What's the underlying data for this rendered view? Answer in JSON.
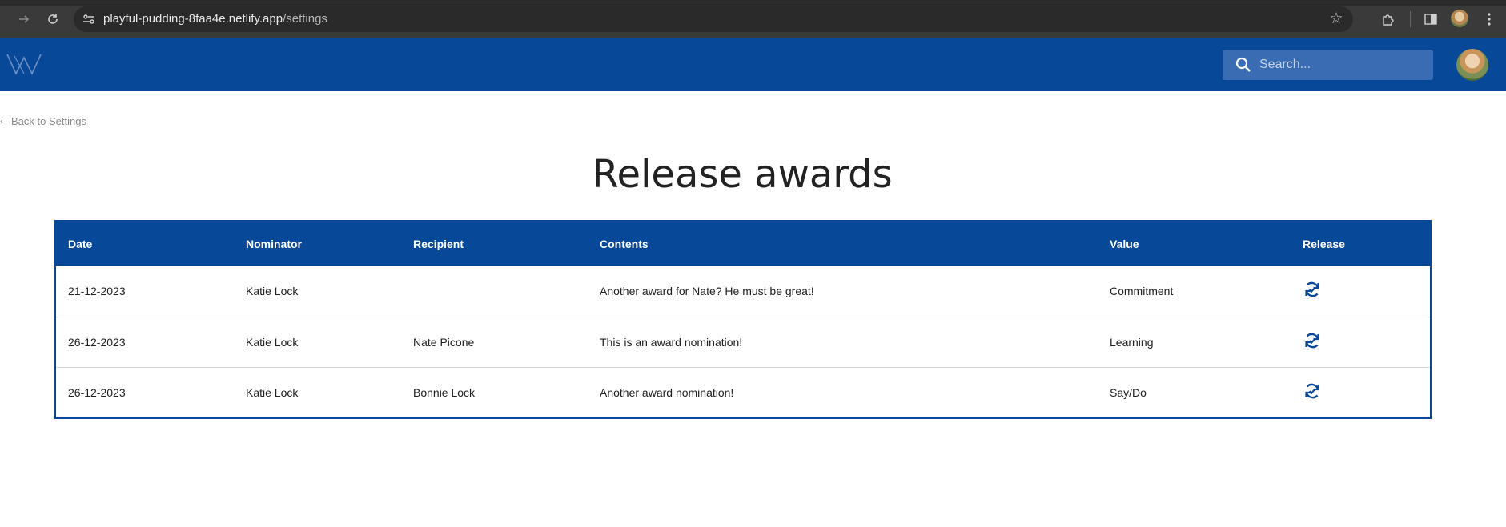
{
  "browser": {
    "url_host": "playful-pudding-8faa4e.netlify.app",
    "url_path": "/settings"
  },
  "header": {
    "search_placeholder": "Search..."
  },
  "back_link": "Back to Settings",
  "page_title": "Release awards",
  "table": {
    "columns": [
      "Date",
      "Nominator",
      "Recipient",
      "Contents",
      "Value",
      "Release"
    ],
    "rows": [
      {
        "date": "21-12-2023",
        "nominator": "Katie Lock",
        "recipient": "",
        "contents": "Another award for Nate? He must be great!",
        "value": "Commitment"
      },
      {
        "date": "26-12-2023",
        "nominator": "Katie Lock",
        "recipient": "Nate Picone",
        "contents": "This is an award nomination!",
        "value": "Learning"
      },
      {
        "date": "26-12-2023",
        "nominator": "Katie Lock",
        "recipient": "Bonnie Lock",
        "contents": "Another award nomination!",
        "value": "Say/Do"
      }
    ]
  },
  "colors": {
    "brand_blue": "#084898",
    "search_bg": "#3a6cb3"
  }
}
